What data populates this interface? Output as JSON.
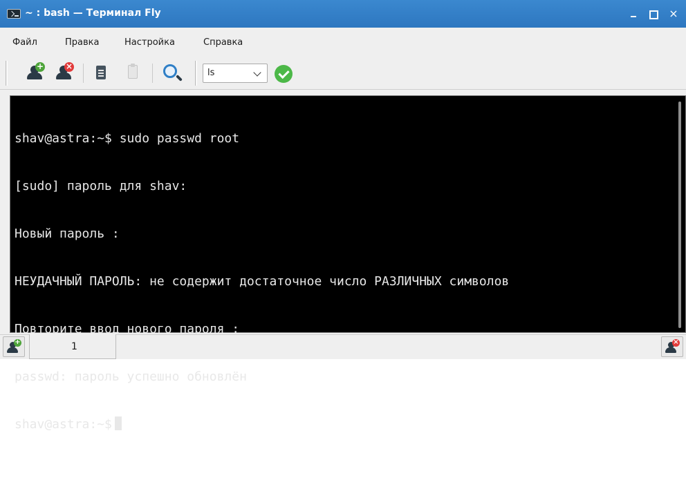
{
  "window": {
    "title": "~ : bash — Терминал Fly",
    "close_symbol": "×"
  },
  "menu": {
    "items": [
      "Файл",
      "Правка",
      "Настройка",
      "Справка"
    ]
  },
  "toolbar": {
    "icons": [
      "new-session-icon",
      "close-session-icon",
      "copy-icon",
      "paste-icon",
      "search-icon",
      "run-command-icon"
    ],
    "command_value": "ls"
  },
  "terminal": {
    "lines": [
      "shav@astra:~$ sudo passwd root",
      "[sudo] пароль для shav:",
      "Новый пароль :",
      "НЕУДАЧНЫЙ ПАРОЛЬ: не содержит достаточное число РАЗЛИЧНЫХ символов",
      "Повторите ввод нового пароля :",
      "passwd: пароль успешно обновлён",
      "shav@astra:~$"
    ]
  },
  "tabs": {
    "items": [
      {
        "label": "1"
      }
    ]
  },
  "colors": {
    "titlebar": "#2d77c0",
    "terminal_bg": "#000000",
    "terminal_fg": "#e8e8e8",
    "add_badge": "#4ea43a",
    "remove_badge": "#e23b3b"
  }
}
